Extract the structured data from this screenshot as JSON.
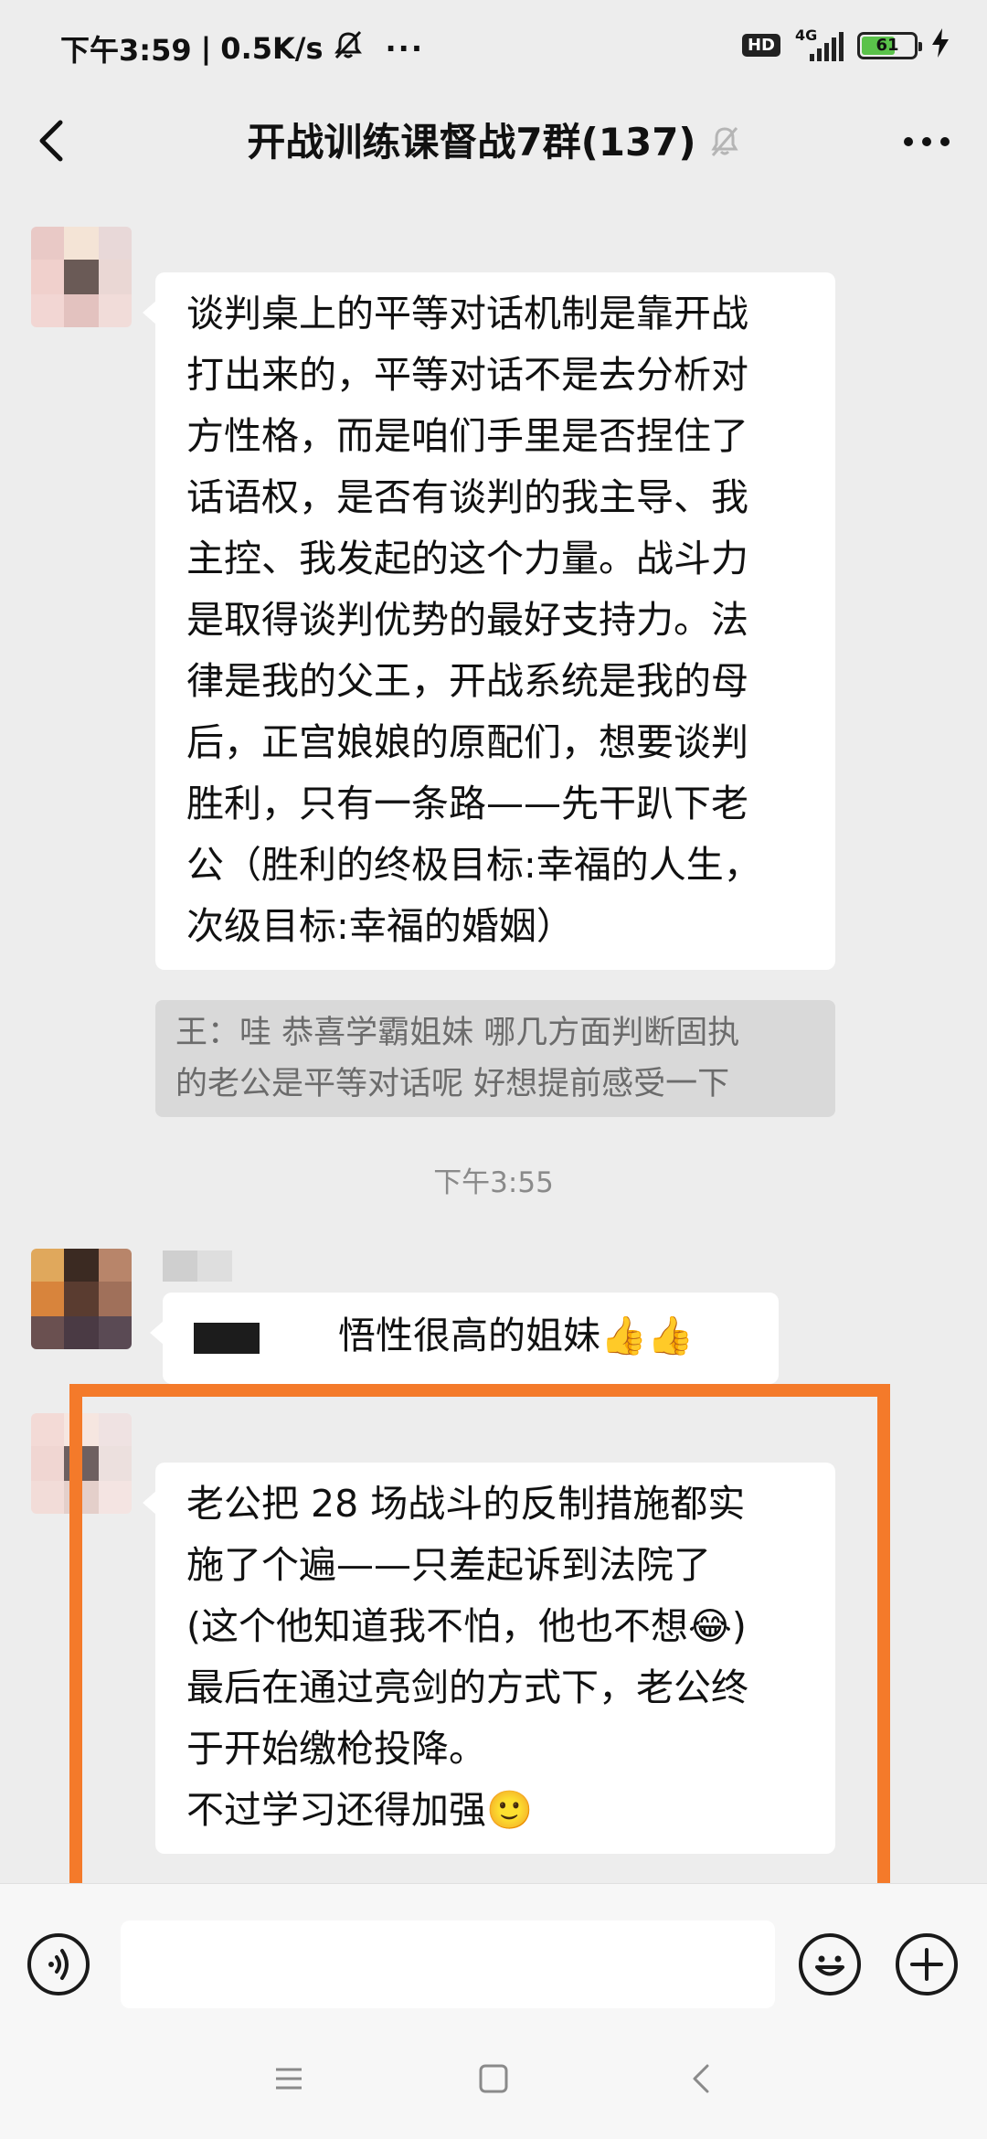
{
  "status_bar": {
    "time": "下午3:59",
    "network_speed": "0.5K/s",
    "separator": "|",
    "more_dots": "···",
    "hd": "HD",
    "network_type": "4G",
    "battery_level": "61",
    "icons": [
      "mute-icon",
      "hd-icon",
      "signal-icon",
      "battery-icon",
      "charging-icon"
    ]
  },
  "header": {
    "title": "开战训练课督战7群(137)",
    "icons": [
      "back-icon",
      "mute-bell-icon",
      "more-icon"
    ]
  },
  "messages": [
    {
      "id": "msg1",
      "lines": [
        "谈判桌上的平等对话机制是靠开战",
        "打出来的，平等对话不是去分析对",
        "方性格，而是咱们手里是否捏住了",
        "话语权，是否有谈判的我主导、我",
        "主控、我发起的这个力量。战斗力",
        "是取得谈判优势的最好支持力。法",
        "律是我的父王，开战系统是我的母",
        "后，正宫娘娘的原配们，想要谈判",
        "胜利，只有一条路——先干趴下老",
        "公（胜利的终极目标:幸福的人生，",
        "次级目标:幸福的婚姻）"
      ],
      "quote_lines": [
        "王：哇 恭喜学霸姐妹  哪几方面判断固执",
        "的老公是平等对话呢 好想提前感受一下"
      ]
    },
    {
      "id": "msg2",
      "text": "悟性很高的姐妹",
      "emoji": "👍👍"
    },
    {
      "id": "msg3",
      "lines": [
        "老公把 28 场战斗的反制措施都实",
        "施了个遍——只差起诉到法院了",
        "(这个他知道我不怕，他也不想😂)",
        "最后在通过亮剑的方式下，老公终",
        "于开始缴枪投降。",
        "不过学习还得加强🙂"
      ]
    }
  ],
  "timestamp": "下午3:55",
  "input_bar": {
    "placeholder": "",
    "icons": [
      "voice-icon",
      "emoji-icon",
      "plus-icon"
    ]
  },
  "system_nav": {
    "icons": [
      "menu-icon",
      "home-icon",
      "back-nav-icon"
    ]
  },
  "colors": {
    "background": "#ededed",
    "bubble": "#ffffff",
    "quote_bg": "#d9d9d9",
    "highlight": "#f47a2a",
    "battery": "#5ac24a"
  }
}
